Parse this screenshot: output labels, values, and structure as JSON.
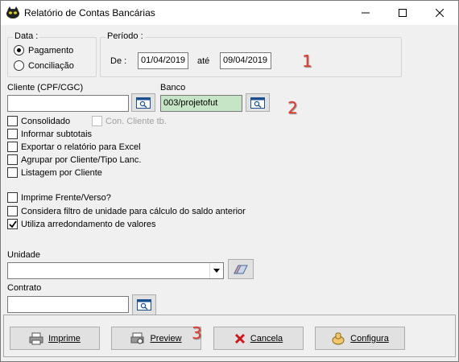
{
  "window": {
    "title": "Relatório de Contas Bancárias",
    "controls": {
      "minimize": "minimize",
      "maximize": "maximize",
      "close": "close"
    }
  },
  "data_group": {
    "legend": "Data :",
    "options": [
      {
        "label": "Pagamento",
        "selected": true
      },
      {
        "label": "Conciliação",
        "selected": false
      }
    ]
  },
  "periodo_group": {
    "legend": "Período :",
    "de_label": "De :",
    "de_value": "01/04/2019",
    "ate_label": "até",
    "ate_value": "09/04/2019"
  },
  "cliente": {
    "label": "Cliente (CPF/CGC)",
    "value": ""
  },
  "banco": {
    "label": "Banco",
    "value": "003/projetofut"
  },
  "checkboxes": {
    "consolidado": {
      "label": "Consolidado",
      "checked": false
    },
    "con_cliente": {
      "label": "Con. Cliente tb.",
      "checked": false,
      "disabled": true
    },
    "informar_subtotais": {
      "label": "Informar subtotais",
      "checked": false
    },
    "exportar_excel": {
      "label": "Exportar o relatório para Excel",
      "checked": false
    },
    "agrupar": {
      "label": "Agrupar por Cliente/Tipo Lanc.",
      "checked": false
    },
    "listagem": {
      "label": "Listagem por Cliente",
      "checked": false
    },
    "frente_verso": {
      "label": "Imprime Frente/Verso?",
      "checked": false
    },
    "filtro_unidade": {
      "label": "Considera filtro de unidade para cálculo do saldo anterior",
      "checked": false
    },
    "arredondamento": {
      "label": "Utiliza arredondamento de valores",
      "checked": true
    }
  },
  "unidade": {
    "label": "Unidade",
    "value": ""
  },
  "contrato": {
    "label": "Contrato",
    "value": ""
  },
  "footer_buttons": {
    "imprime": {
      "label": "Imprime",
      "icon": "printer-icon"
    },
    "preview": {
      "label": "Preview",
      "icon": "preview-icon"
    },
    "cancela": {
      "label": "Cancela",
      "icon": "red-x-icon"
    },
    "configura": {
      "label": "Configura",
      "icon": "settings-hand-icon"
    }
  },
  "annotations": {
    "one": "1",
    "two": "2",
    "three": "3"
  },
  "colors": {
    "banco_field_bg": "#c6e5c6",
    "marker": "#e23b2c",
    "check_mark": "#000000"
  }
}
